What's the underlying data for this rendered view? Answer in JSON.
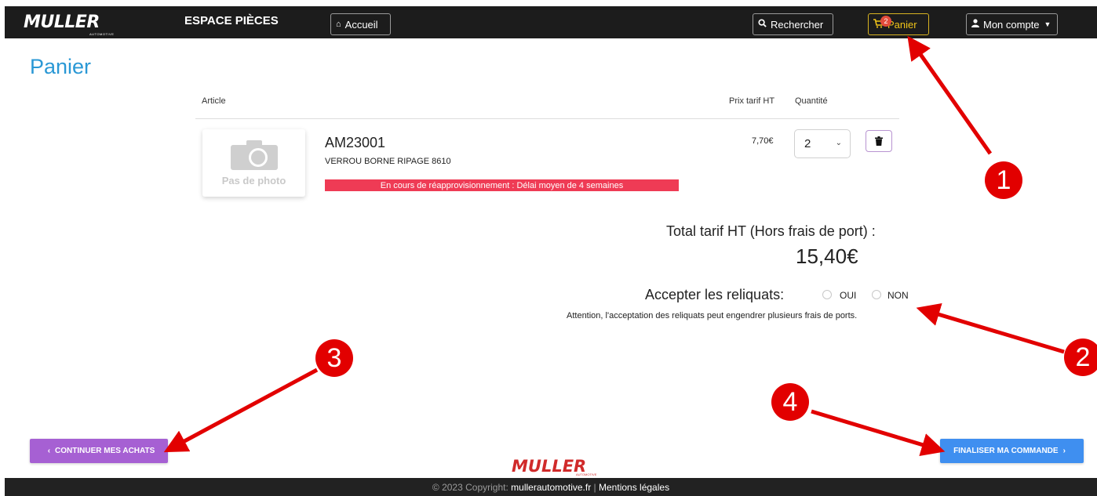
{
  "header": {
    "logo_text": "MULLER",
    "logo_sub": "AUTOMOTIVE",
    "brand_title": "ESPACE PIÈCES",
    "nav": {
      "home_label": "Accueil",
      "search_label": "Rechercher",
      "cart_label": "Panier",
      "cart_count": "2",
      "account_label": "Mon compte"
    }
  },
  "page": {
    "title": "Panier"
  },
  "cart_table": {
    "headers": {
      "article": "Article",
      "price": "Prix tarif HT",
      "quantity": "Quantité"
    },
    "items": [
      {
        "photo_label": "Pas de photo",
        "reference": "AM23001",
        "designation": "VERROU BORNE RIPAGE 8610",
        "stock_alert": "En cours de réapprovisionnement : Délai moyen de 4 semaines",
        "price": "7,70€",
        "quantity": "2"
      }
    ]
  },
  "summary": {
    "total_label": "Total tarif HT (Hors frais de port) :",
    "total_value": "15,40€",
    "reliquats_label": "Accepter les reliquats:",
    "option_yes": "OUI",
    "option_no": "NON",
    "reliquats_warning": "Attention, l'acceptation des reliquats peut engendrer plusieurs frais de ports."
  },
  "actions": {
    "continue_label": "CONTINUER MES ACHATS",
    "finalize_label": "FINALISER MA COMMANDE"
  },
  "footer": {
    "logo_text": "MULLER",
    "logo_sub": "AUTOMOTIVE",
    "copyright_prefix": "© 2023 Copyright:",
    "site_link": "mullerautomotive.fr",
    "separator": "|",
    "legal_link": "Mentions légales"
  },
  "annotations": [
    "1",
    "2",
    "3",
    "4"
  ],
  "colors": {
    "navbar_bg": "#1c1c1c",
    "title_blue": "#2a98d5",
    "alert_red": "#ef3b55",
    "continue_purple": "#a660d3",
    "finalize_blue": "#3f8ff0",
    "annotation_red": "#e20000",
    "cart_gold": "#f0c419"
  }
}
